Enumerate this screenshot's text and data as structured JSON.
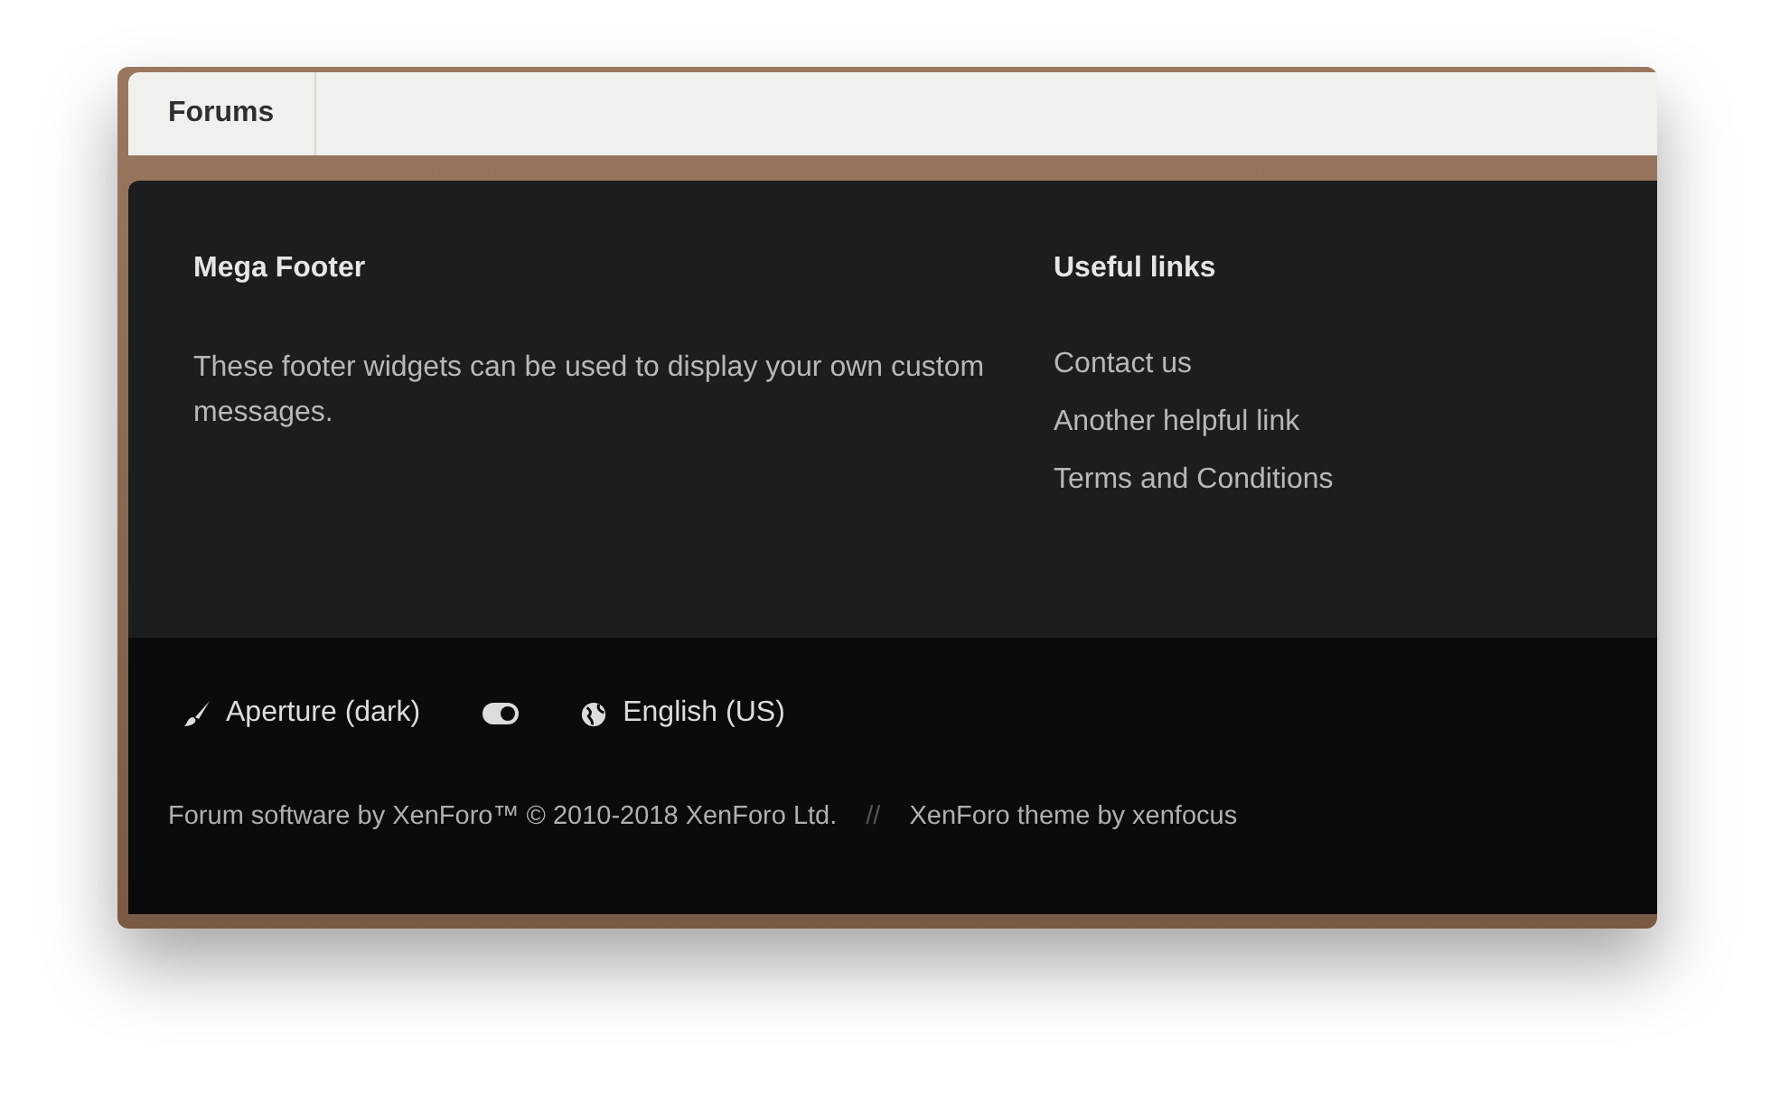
{
  "breadcrumb": [
    {
      "label": "Forums"
    }
  ],
  "footer": {
    "columns": [
      {
        "kind": "text",
        "title": "Mega Footer",
        "body": "These footer widgets can be used to display your own custom messages."
      },
      {
        "kind": "links",
        "title": "Useful links",
        "links": [
          "Contact us",
          "Another helpful link",
          "Terms and Conditions"
        ]
      }
    ]
  },
  "bottom_bar": {
    "style": "Aperture (dark)",
    "toggle": {
      "on": true
    },
    "language": "English (US)",
    "copyright": "Forum software by XenForo™ © 2010-2018 XenForo Ltd.",
    "separator": "//",
    "theme_credit": "XenForo theme by xenfocus"
  }
}
